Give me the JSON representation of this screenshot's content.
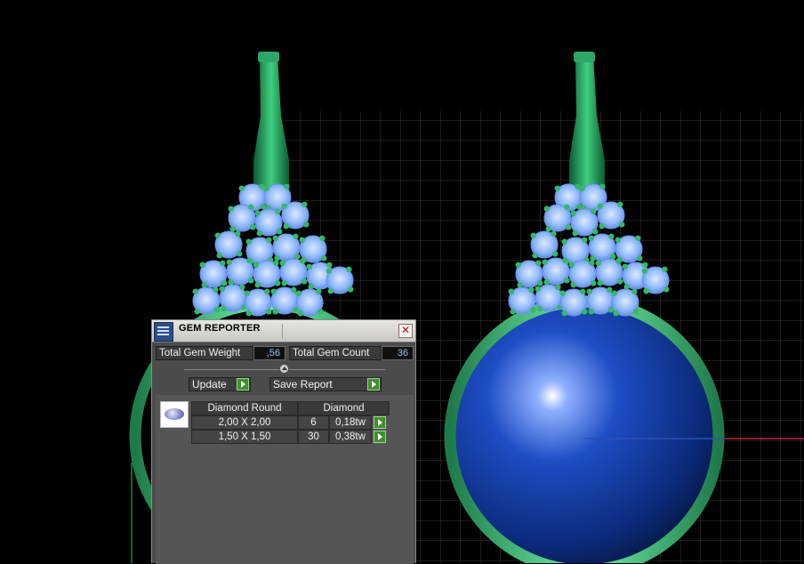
{
  "window": {
    "title": "GEM REPORTER"
  },
  "summary": {
    "weight_label": "Total Gem Weight",
    "weight_value": ",56",
    "count_label": "Total Gem Count",
    "count_value": "36"
  },
  "actions": {
    "update_label": "Update",
    "save_label": "Save Report"
  },
  "table": {
    "headers": [
      "Diamond Round",
      "Diamond"
    ],
    "rows": [
      {
        "size": "2,00 X 2,00",
        "count": "6",
        "weight": "0,18tw"
      },
      {
        "size": "1,50 X 1,50",
        "count": "30",
        "weight": "0,38tw"
      }
    ]
  },
  "colors": {
    "value_text": "#8fc8ff",
    "go_button": "#3f8f2e",
    "metal": "#3fbf77",
    "stone": "#1e3fa8",
    "diamond": "#8fb8ff"
  }
}
